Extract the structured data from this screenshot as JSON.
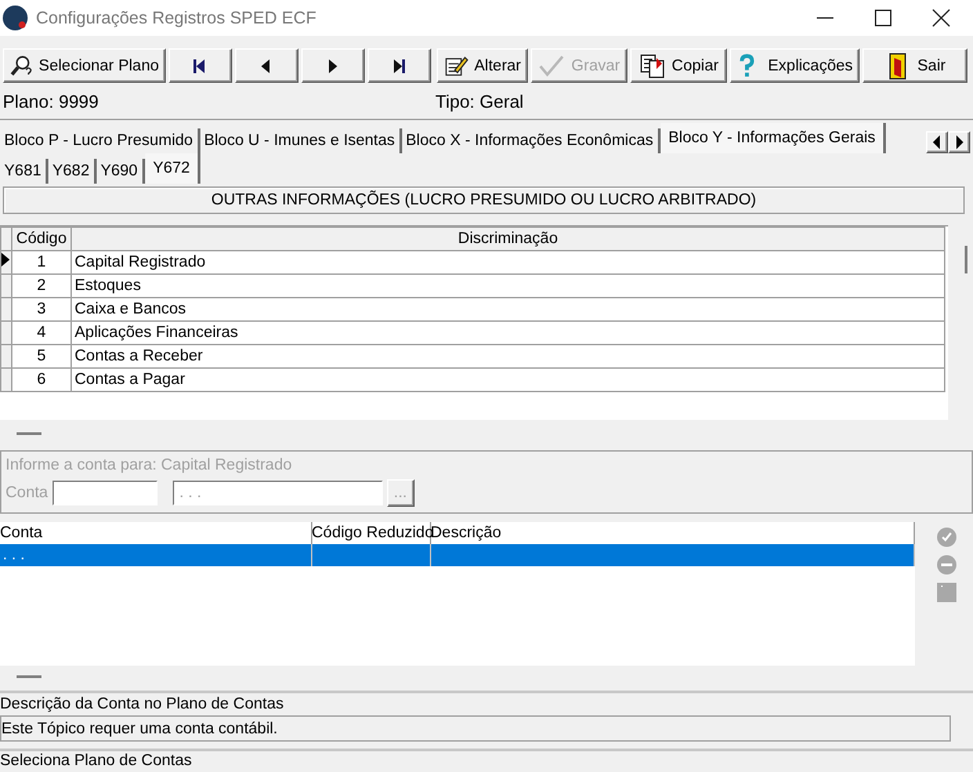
{
  "window": {
    "title": "Configurações Registros SPED ECF"
  },
  "toolbar": [
    {
      "kind": "search",
      "label": "Selecionar Plano",
      "disabled": false
    },
    {
      "kind": "first",
      "disabled": false
    },
    {
      "kind": "prev",
      "disabled": false
    },
    {
      "kind": "next",
      "disabled": false
    },
    {
      "kind": "last",
      "disabled": false
    },
    {
      "kind": "edit",
      "label": "Alterar",
      "disabled": false
    },
    {
      "kind": "save",
      "label": "Gravar",
      "disabled": true
    },
    {
      "kind": "copy",
      "label": "Copiar",
      "disabled": false
    },
    {
      "kind": "help",
      "label": "Explicações",
      "disabled": false
    },
    {
      "kind": "exit",
      "label": "Sair",
      "disabled": false
    }
  ],
  "info": {
    "plan": "Plano: 9999",
    "type": "Tipo:  Geral"
  },
  "tabs": [
    {
      "label": "Bloco P - Lucro Presumido",
      "selected": false
    },
    {
      "label": "Bloco U - Imunes e Isentas",
      "selected": false
    },
    {
      "label": "Bloco X - Informações  Econômicas",
      "selected": false
    },
    {
      "label": "Bloco Y - Informações Gerais",
      "selected": true
    }
  ],
  "subtabs": [
    {
      "label": "Y681",
      "selected": false
    },
    {
      "label": "Y682",
      "selected": false
    },
    {
      "label": "Y690",
      "selected": false
    },
    {
      "label": "Y672",
      "selected": true
    }
  ],
  "section_title": "OUTRAS INFORMAÇÕES (LUCRO PRESUMIDO OU LUCRO ARBITRADO)",
  "table": {
    "columns": [
      "Código",
      "Discriminação"
    ],
    "rows": [
      {
        "code": "1",
        "name": "Capital Registrado",
        "selected": true
      },
      {
        "code": "2",
        "name": "Estoques",
        "selected": false
      },
      {
        "code": "3",
        "name": "Caixa e Bancos",
        "selected": false
      },
      {
        "code": "4",
        "name": "Aplicações Financeiras",
        "selected": false
      },
      {
        "code": "5",
        "name": "Contas a Receber",
        "selected": false
      },
      {
        "code": "6",
        "name": "Contas a Pagar",
        "selected": false
      }
    ]
  },
  "account_group": {
    "caption": "Informe a conta para: Capital Registrado",
    "field_label": "Conta",
    "mask": ". . .",
    "browse": "...",
    "disabled": true
  },
  "accounts": {
    "columns": [
      "Conta",
      "Código Reduzido",
      "Descrição"
    ],
    "rows": [
      {
        "conta": ". . .",
        "selected": true
      }
    ]
  },
  "description": {
    "label": "Descrição da Conta no Plano de Contas",
    "text": "Este Tópico requer uma conta contábil."
  },
  "status_bar": "Seleciona Plano de Contas"
}
